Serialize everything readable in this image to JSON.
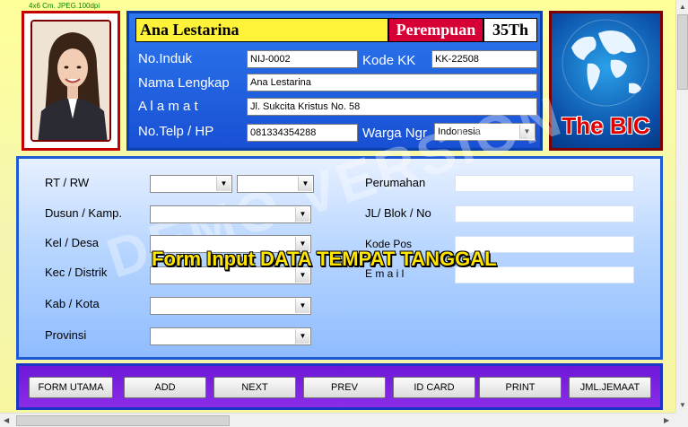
{
  "photo": {
    "caption": "4x6 Cm. JPEG.100dpi"
  },
  "header": {
    "name": "Ana Lestarina",
    "gender": "Perempuan",
    "age": "35Th",
    "labels": {
      "no_induk": "No.Induk",
      "kode_kk": "Kode KK",
      "nama_lengkap": "Nama Lengkap",
      "alamat": "A l a m a t",
      "no_telp": "No.Telp / HP",
      "warga_ngr": "Warga Ngr"
    },
    "values": {
      "no_induk": "NIJ-0002",
      "kode_kk": "KK-22508",
      "nama_lengkap": "Ana Lestarina",
      "alamat": "Jl. Sukcita Kristus No. 58",
      "no_telp": "081334354288",
      "warga_ngr": "Indonesia"
    }
  },
  "logo": {
    "text": "The BIC"
  },
  "form": {
    "labels": {
      "rt_rw": "RT / RW",
      "dusun": "Dusun / Kamp.",
      "kel": "Kel / Desa",
      "kec": "Kec / Distrik",
      "kab": "Kab / Kota",
      "provinsi": "Provinsi",
      "perumahan": "Perumahan",
      "jl_blok": "JL/ Blok / No",
      "kode_pos": "Kode Pos",
      "email": "E m a i l"
    },
    "overlay_title": "Form Input DATA TEMPAT TANGGAL",
    "watermark": "DEMO VERSION"
  },
  "buttons": {
    "form_utama": "FORM UTAMA",
    "add": "ADD",
    "next": "NEXT",
    "prev": "PREV",
    "id_card": "ID CARD",
    "print": "PRINT",
    "jml_jemaat": "JML.JEMAAT"
  },
  "colors": {
    "header_blue": "#1850d4",
    "gender_red": "#d60036",
    "name_yellow": "#fff33a",
    "button_bar_purple": "#7a22e0",
    "overlay_yellow": "#ffe400"
  },
  "icons": {
    "combo_arrow": "chevron-down-icon",
    "logo_globe": "globe-icon"
  }
}
